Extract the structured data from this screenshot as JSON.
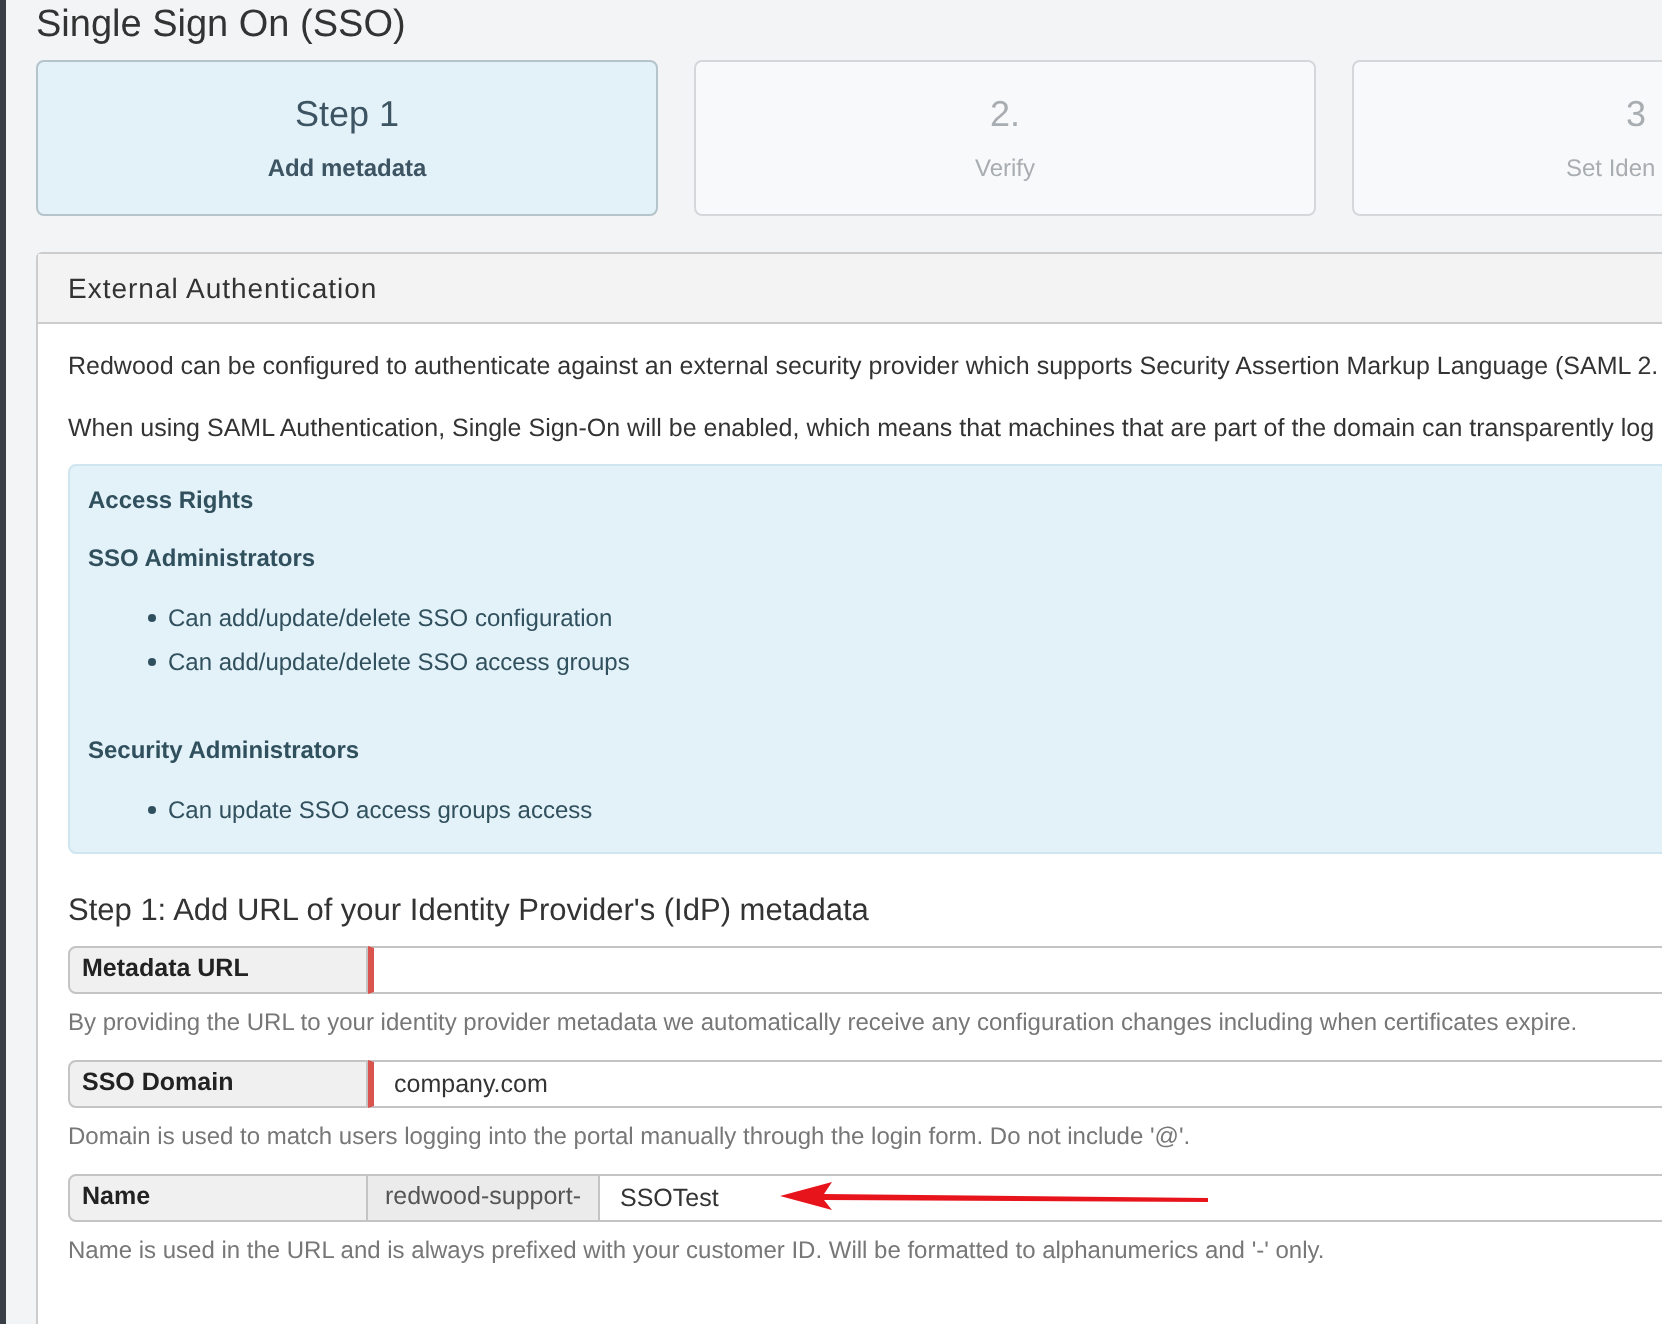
{
  "page_title": "Single Sign On (SSO)",
  "steps": [
    {
      "title": "Step 1",
      "subtitle": "Add metadata",
      "selected": true
    },
    {
      "title": "2.",
      "subtitle": "Verify",
      "selected": false
    },
    {
      "title": "3",
      "subtitle": "Set Iden",
      "selected": false
    }
  ],
  "panel": {
    "title": "External Authentication",
    "paragraphs": [
      "Redwood can be configured to authenticate against an external security provider which supports Security Assertion Markup Language (SAML 2.",
      "When using SAML Authentication, Single Sign-On will be enabled, which means that machines that are part of the domain can transparently log"
    ],
    "info_box": {
      "title": "Access Rights",
      "groups": [
        {
          "title": "SSO Administrators",
          "items": [
            "Can add/update/delete SSO configuration",
            "Can add/update/delete SSO access groups"
          ]
        },
        {
          "title": "Security Administrators",
          "items": [
            "Can update SSO access groups access"
          ]
        }
      ]
    },
    "form_heading": "Step 1: Add URL of your Identity Provider's (IdP) metadata",
    "fields": [
      {
        "label": "Metadata URL",
        "invalid": true,
        "help": "By providing the URL to your identity provider metadata we automatically receive any configuration changes including when certificates expire."
      },
      {
        "label": "SSO Domain",
        "value": "company.com",
        "invalid": true,
        "help": "Domain is used to match users logging into the portal manually through the login form. Do not include '@'."
      },
      {
        "label": "Name",
        "prefix": "redwood-support-",
        "value": "SSOTest",
        "invalid": false,
        "annotated": true,
        "help": "Name is used in the URL and is always prefixed with your customer ID. Will be formatted to alphanumerics and '-' only."
      }
    ]
  }
}
